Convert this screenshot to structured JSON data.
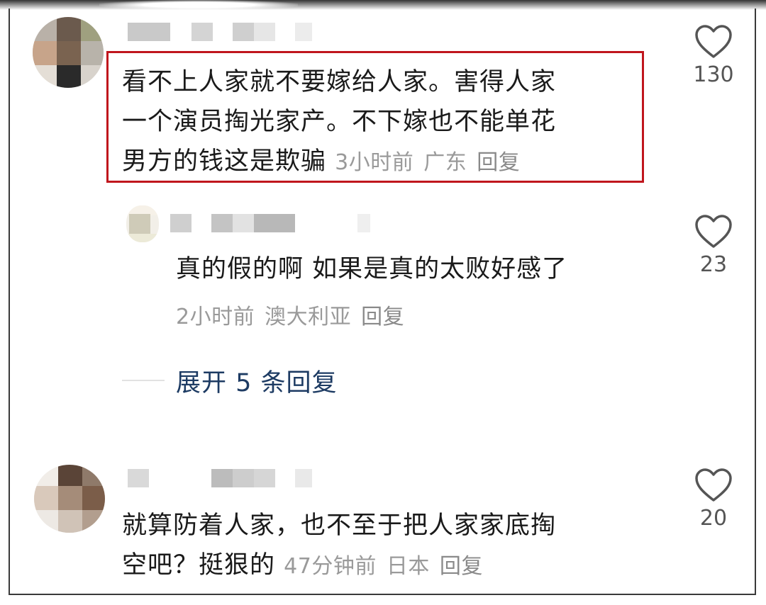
{
  "comments": [
    {
      "text": "看不上人家就不要嫁给人家。害得人家一个演员掏光家产。不下嫁也不能单花男方的钱这是欺骗",
      "line1": "看不上人家就不要嫁给人家。害得人家",
      "line2": "一个演员掏光家产。不下嫁也不能单花",
      "line3": "男方的钱这是欺骗",
      "time": "3小时前",
      "location": "广东",
      "reply_label": "回复",
      "likes": "130",
      "avatar_icon": "pixelated-avatar"
    }
  ],
  "reply": {
    "text": "真的假的啊 如果是真的太败好感了",
    "time": "2小时前",
    "location": "澳大利亚",
    "reply_label": "回复",
    "likes": "23",
    "avatar_icon": "pixelated-avatar"
  },
  "expand_label": "展开 5 条回复",
  "comment2": {
    "line1": "就算防着人家，也不至于把人家家底掏",
    "line2": "空吧？挺狠的",
    "time": "47分钟前",
    "location": "日本",
    "reply_label": "回复",
    "likes": "20",
    "avatar_icon": "pixelated-avatar"
  },
  "colors": {
    "highlight_border": "#c0161d",
    "expand_link": "#1d3b63",
    "meta_text": "#9a9a9a"
  },
  "icons": {
    "like": "heart-outline-icon"
  }
}
